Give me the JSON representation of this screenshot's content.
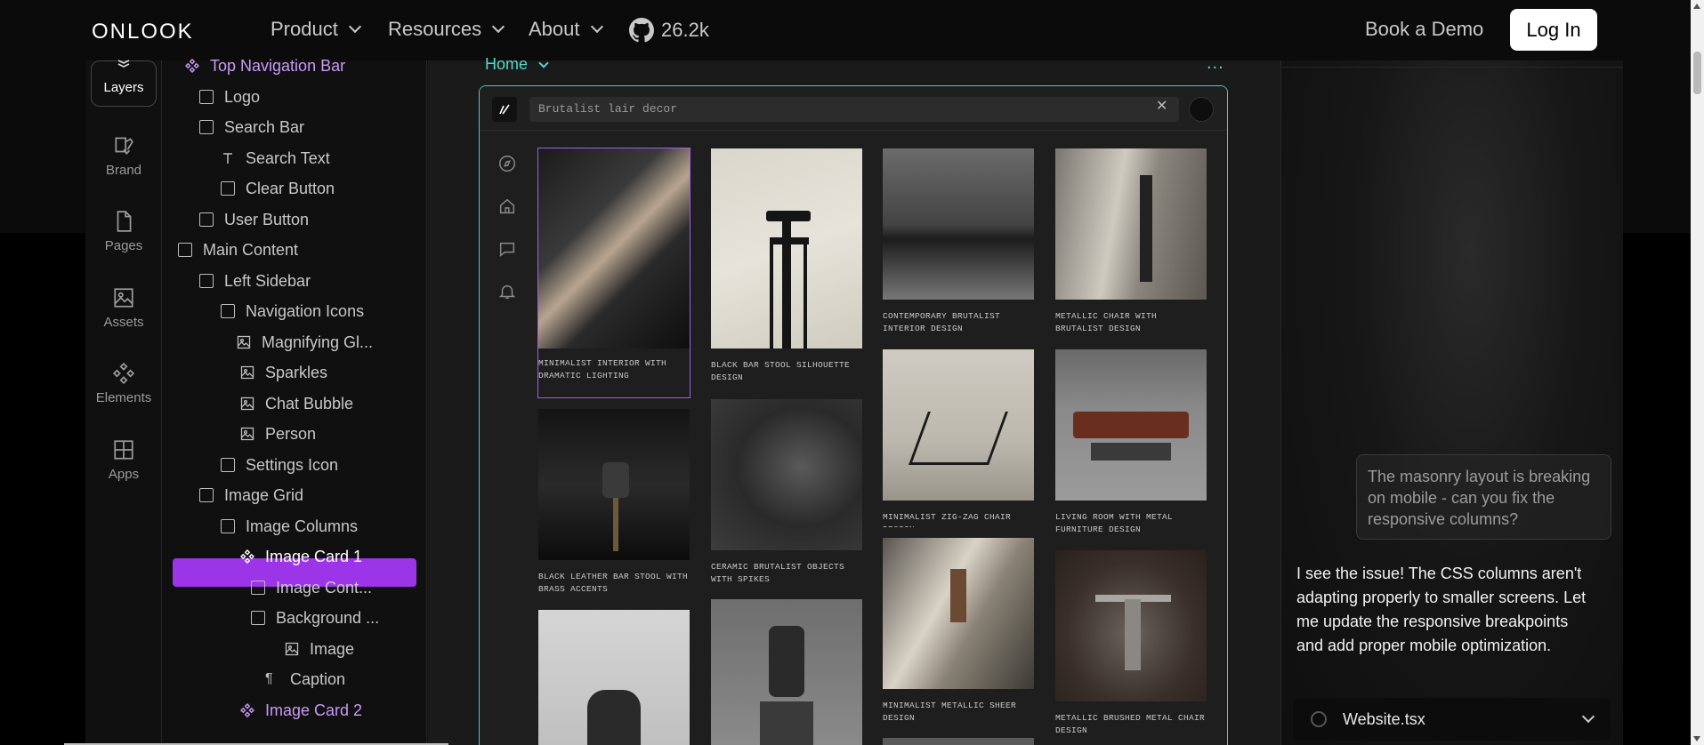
{
  "nav": {
    "logo": "ONLOOK",
    "items": [
      "Product",
      "Resources",
      "About"
    ],
    "github_stars": "26.2k",
    "book_demo": "Book a Demo",
    "login": "Log In"
  },
  "rail": {
    "items": [
      "Layers",
      "Brand",
      "Pages",
      "Assets",
      "Elements",
      "Apps"
    ]
  },
  "layers": {
    "items": [
      {
        "label": "Top Navigation Bar"
      },
      {
        "label": "Logo"
      },
      {
        "label": "Search Bar"
      },
      {
        "label": "Search Text"
      },
      {
        "label": "Clear Button"
      },
      {
        "label": "User Button"
      },
      {
        "label": "Main Content"
      },
      {
        "label": "Left Sidebar"
      },
      {
        "label": "Navigation Icons"
      },
      {
        "label": "Magnifying Gl..."
      },
      {
        "label": "Sparkles"
      },
      {
        "label": "Chat Bubble"
      },
      {
        "label": "Person"
      },
      {
        "label": "Settings Icon"
      },
      {
        "label": "Image Grid"
      },
      {
        "label": "Image Columns"
      },
      {
        "label": "Image Card 1"
      },
      {
        "label": "Image Cont..."
      },
      {
        "label": "Background ..."
      },
      {
        "label": "Image"
      },
      {
        "label": "Caption"
      },
      {
        "label": "Image Card 2"
      }
    ]
  },
  "canvas": {
    "page_selector": "Home",
    "more": "...",
    "search_value": "Brutalist lair decor",
    "cards": [
      {
        "caption": "Minimalist interior with dramatic lighting"
      },
      {
        "caption": "Black bar stool silhouette design"
      },
      {
        "caption": "Contemporary brutalist interior design"
      },
      {
        "caption": "Metallic chair with brutalist design"
      },
      {
        "caption": "Black leather bar stool with brass accents"
      },
      {
        "caption": "Ceramic brutalist objects with spikes"
      },
      {
        "caption": "Minimalist zig-zag chair design"
      },
      {
        "caption": "Living room with metal furniture design"
      },
      {
        "caption": "Minimalist metallic sheer design"
      },
      {
        "caption": "Metallic brushed metal chair design"
      }
    ]
  },
  "chat": {
    "user_message": "The masonry layout is breaking on mobile - can you fix the responsive columns?",
    "assistant_message": "I see the issue! The CSS columns aren't adapting properly to smaller screens. Let me update the responsive breakpoints and add proper mobile optimization.",
    "file_name": "Website.tsx"
  },
  "colors": {
    "accent_purple": "#9c35e8",
    "frame_teal": "#3fd0c0",
    "purple_text": "#c89af7"
  }
}
